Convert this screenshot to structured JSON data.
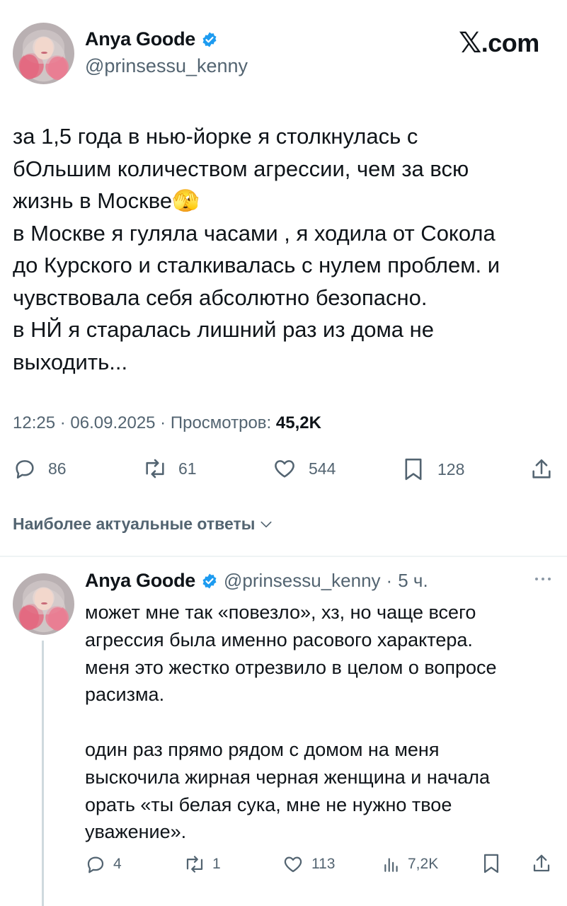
{
  "site": {
    "logo_x": "𝕏",
    "logo_text": ".com"
  },
  "main_tweet": {
    "author_name": "Anya Goode",
    "handle": "@prinsessu_kenny",
    "text_lines": [
      "за 1,5 года в нью-йорке я столкнулась с",
      "бОльшим количеством агрессии, чем за всю",
      "жизнь в Москве🫣",
      "в Москве я гуляла часами , я ходила от Сокола",
      "до Курского и сталкивалась с нулем проблем. и",
      "чувствовала себя абсолютно безопасно.",
      "в НЙ я старалась лишний раз из дома не",
      "выходить..."
    ],
    "time": "12:25",
    "date": "06.09.2025",
    "views_label": "Просмотров:",
    "views": "45,2K",
    "stats": {
      "replies": "86",
      "reposts": "61",
      "likes": "544",
      "bookmarks": "128"
    }
  },
  "sort": {
    "label": "Наиболее актуальные ответы"
  },
  "reply": {
    "author_name": "Anya Goode",
    "handle": "@prinsessu_kenny",
    "age": "5 ч.",
    "text_lines": [
      "может мне так «повезло», хз, но чаще всего",
      "агрессия была именно расового характера.",
      "меня это жестко отрезвило в целом о вопросе",
      "расизма.",
      "",
      "один раз прямо рядом с домом на меня",
      "выскочила жирная черная женщина и начала",
      "орать «ты белая сука, мне не нужно твое",
      "уважение»."
    ],
    "stats": {
      "replies": "4",
      "reposts": "1",
      "likes": "113",
      "views": "7,2K"
    }
  },
  "colors": {
    "verified": "#1d9bf0",
    "muted": "#536471",
    "text": "#0f1419",
    "divider": "#eff3f4"
  },
  "icons": [
    "verified-badge-icon",
    "reply-icon",
    "repost-icon",
    "like-icon",
    "bookmark-icon",
    "share-icon",
    "views-icon",
    "more-icon",
    "chevron-down-icon"
  ]
}
